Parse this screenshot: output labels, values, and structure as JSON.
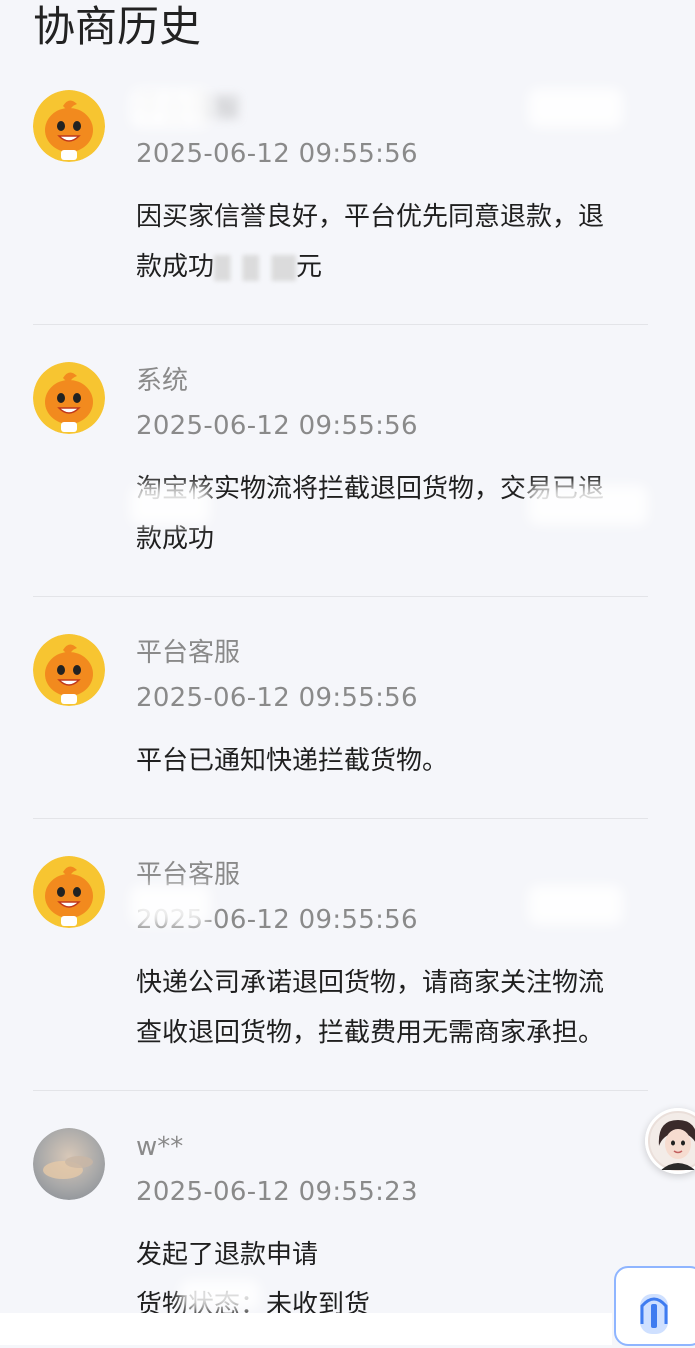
{
  "page": {
    "title": "协商历史"
  },
  "entries": [
    {
      "author": "平台客服",
      "time": "2025-06-12 09:55:56",
      "content_lines": [
        "因买家信誉良好，平台优先同意退款，退",
        "款成功",
        "元"
      ],
      "avatar": "mascot-icon"
    },
    {
      "author": "系统",
      "time": "2025-06-12 09:55:56",
      "content_lines": [
        "淘宝核实物流将拦截退回货物，交易已退",
        "款成功"
      ],
      "avatar": "mascot-icon"
    },
    {
      "author": "平台客服",
      "time": "2025-06-12 09:55:56",
      "content_lines": [
        "平台已通知快递拦截货物。"
      ],
      "avatar": "mascot-icon"
    },
    {
      "author": "平台客服",
      "time": "2025-06-12 09:55:56",
      "content_lines": [
        "快递公司承诺退回货物，请商家关注物流",
        "查收退回货物，拦截费用无需商家承担。"
      ],
      "avatar": "mascot-icon"
    },
    {
      "author": "w**",
      "time": "2025-06-12 09:55:23",
      "content_lines": [
        "发起了退款申请",
        "货物状态：未收到货"
      ],
      "avatar": "user-photo"
    }
  ],
  "colors": {
    "background": "#f5f6fa",
    "secondary_text": "#8a8a8a",
    "mascot": "#f28a1e",
    "mascot_ring": "#f7c531"
  }
}
